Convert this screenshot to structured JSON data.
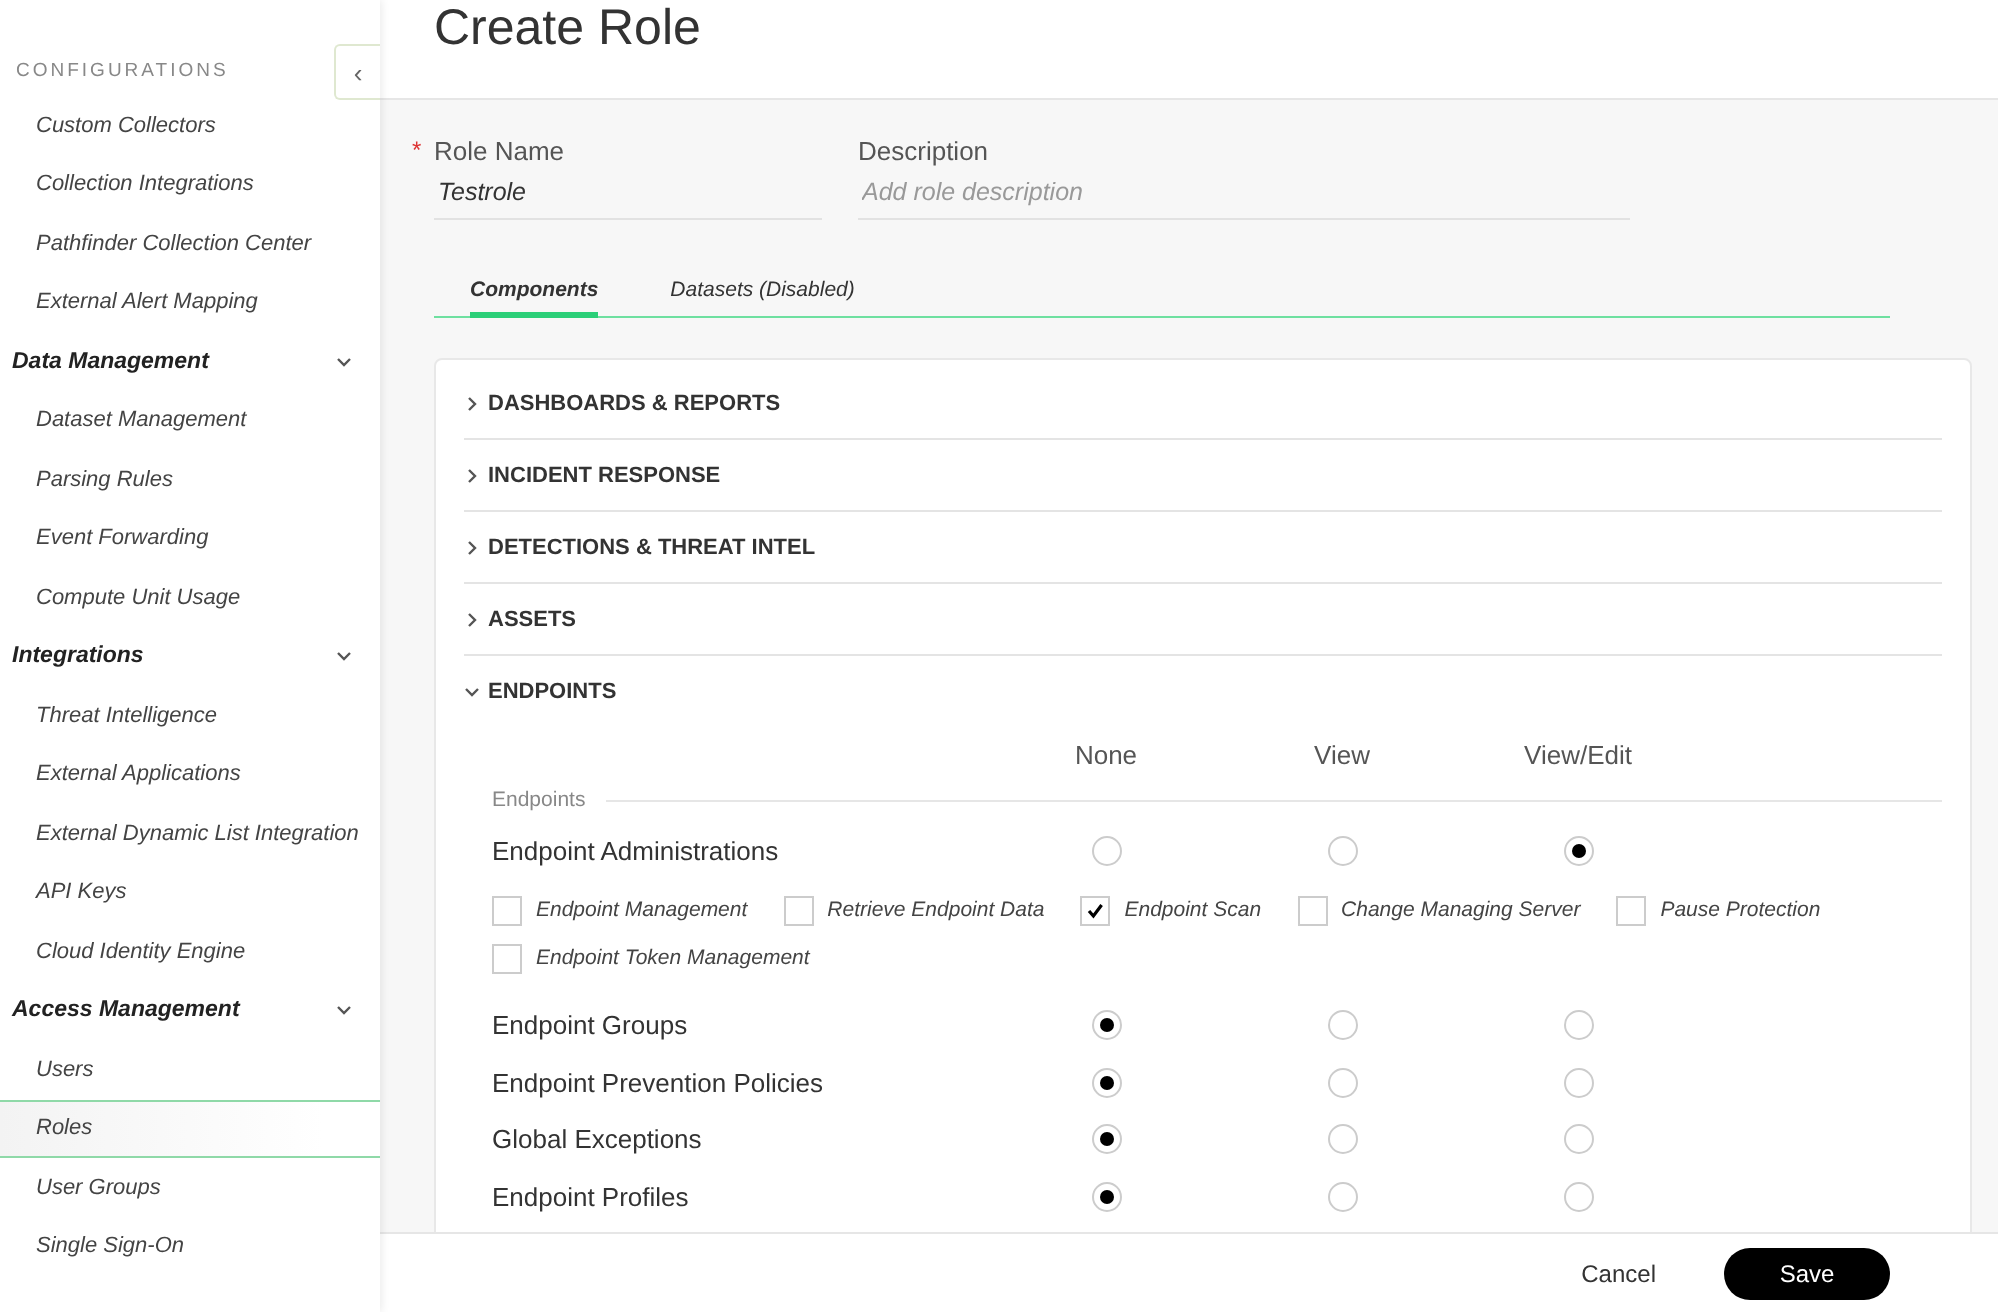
{
  "sidebar": {
    "collapse_icon": "‹",
    "sections": [
      {
        "kind": "caps",
        "title": "CONFIGURATIONS",
        "items": [
          {
            "label": "Custom Collectors",
            "selected": false
          },
          {
            "label": "Collection Integrations",
            "selected": false
          },
          {
            "label": "Pathfinder Collection Center",
            "selected": false
          },
          {
            "label": "External Alert Mapping",
            "selected": false
          }
        ]
      },
      {
        "kind": "group",
        "title": "Data Management",
        "expanded": true,
        "items": [
          {
            "label": "Dataset Management",
            "selected": false
          },
          {
            "label": "Parsing Rules",
            "selected": false
          },
          {
            "label": "Event Forwarding",
            "selected": false
          },
          {
            "label": "Compute Unit Usage",
            "selected": false
          }
        ]
      },
      {
        "kind": "group",
        "title": "Integrations",
        "expanded": true,
        "items": [
          {
            "label": "Threat Intelligence",
            "selected": false
          },
          {
            "label": "External Applications",
            "selected": false
          },
          {
            "label": "External Dynamic List Integration",
            "selected": false
          },
          {
            "label": "API Keys",
            "selected": false
          },
          {
            "label": "Cloud Identity Engine",
            "selected": false
          }
        ]
      },
      {
        "kind": "group",
        "title": "Access Management",
        "expanded": true,
        "items": [
          {
            "label": "Users",
            "selected": false
          },
          {
            "label": "Roles",
            "selected": true
          },
          {
            "label": "User Groups",
            "selected": false
          },
          {
            "label": "Single Sign-On",
            "selected": false
          }
        ]
      }
    ]
  },
  "page_title": "Create Role",
  "form": {
    "role_name": {
      "label": "Role Name",
      "required_mark": "*",
      "value": "Testrole"
    },
    "description": {
      "label": "Description",
      "placeholder": "Add role description"
    }
  },
  "tabs": [
    {
      "label": "Components",
      "selected": true
    },
    {
      "label": "Datasets (Disabled)",
      "selected": false
    }
  ],
  "accordion": [
    {
      "title": "DASHBOARDS & REPORTS",
      "expanded": false
    },
    {
      "title": "INCIDENT RESPONSE",
      "expanded": false
    },
    {
      "title": "DETECTIONS & THREAT INTEL",
      "expanded": false
    },
    {
      "title": "ASSETS",
      "expanded": false
    },
    {
      "title": "ENDPOINTS",
      "expanded": true
    }
  ],
  "permissions": {
    "columns": [
      "None",
      "View",
      "View/Edit"
    ],
    "group_label": "Endpoints",
    "rows": [
      {
        "name": "Endpoint Administrations",
        "radios": [
          {
            "selected": false
          },
          {
            "selected": false
          },
          {
            "selected": true
          }
        ],
        "options": [
          {
            "label": "Endpoint Management",
            "checked": false
          },
          {
            "label": "Retrieve Endpoint Data",
            "checked": false
          },
          {
            "label": "Endpoint Scan",
            "checked": true
          },
          {
            "label": "Change Managing Server",
            "checked": false
          },
          {
            "label": "Pause Protection",
            "checked": false
          },
          {
            "label": "Endpoint Token Management",
            "checked": false
          }
        ]
      },
      {
        "name": "Endpoint Groups",
        "radios": [
          {
            "selected": true
          },
          {
            "selected": false
          },
          {
            "selected": false
          }
        ]
      },
      {
        "name": "Endpoint Prevention Policies",
        "radios": [
          {
            "selected": true
          },
          {
            "selected": false
          },
          {
            "selected": false
          }
        ]
      },
      {
        "name": "Global Exceptions",
        "radios": [
          {
            "selected": true
          },
          {
            "selected": false
          },
          {
            "selected": false
          }
        ]
      },
      {
        "name": "Endpoint Profiles",
        "radios": [
          {
            "selected": true
          },
          {
            "selected": false
          },
          {
            "selected": false
          }
        ]
      }
    ]
  },
  "footer": {
    "cancel": "Cancel",
    "save": "Save"
  }
}
